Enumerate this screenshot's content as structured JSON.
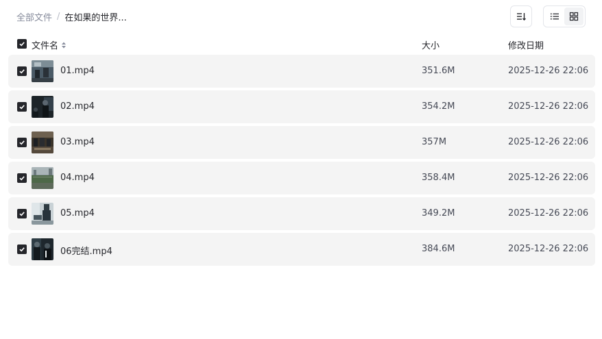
{
  "breadcrumb": {
    "root": "全部文件",
    "separator": "/",
    "current": "在如果的世界..."
  },
  "toolbar": {
    "sort_icon": "sort-lines-icon",
    "list_view_icon": "list-view-icon",
    "grid_view_icon": "grid-view-icon"
  },
  "table": {
    "headers": {
      "name": "文件名",
      "size": "大小",
      "date": "修改日期"
    },
    "rows": [
      {
        "name": "01.mp4",
        "size": "351.6M",
        "date": "2025-12-26 22:06"
      },
      {
        "name": "02.mp4",
        "size": "354.2M",
        "date": "2025-12-26 22:06"
      },
      {
        "name": "03.mp4",
        "size": "357M",
        "date": "2025-12-26 22:06"
      },
      {
        "name": "04.mp4",
        "size": "358.4M",
        "date": "2025-12-26 22:06"
      },
      {
        "name": "05.mp4",
        "size": "349.2M",
        "date": "2025-12-26 22:06"
      },
      {
        "name": "06完结.mp4",
        "size": "384.6M",
        "date": "2025-12-26 22:06"
      }
    ]
  },
  "colors": {
    "text": "#25262b",
    "muted": "#878c9c",
    "row_bg": "#f4f4f4",
    "checkbox": "#25262b"
  }
}
